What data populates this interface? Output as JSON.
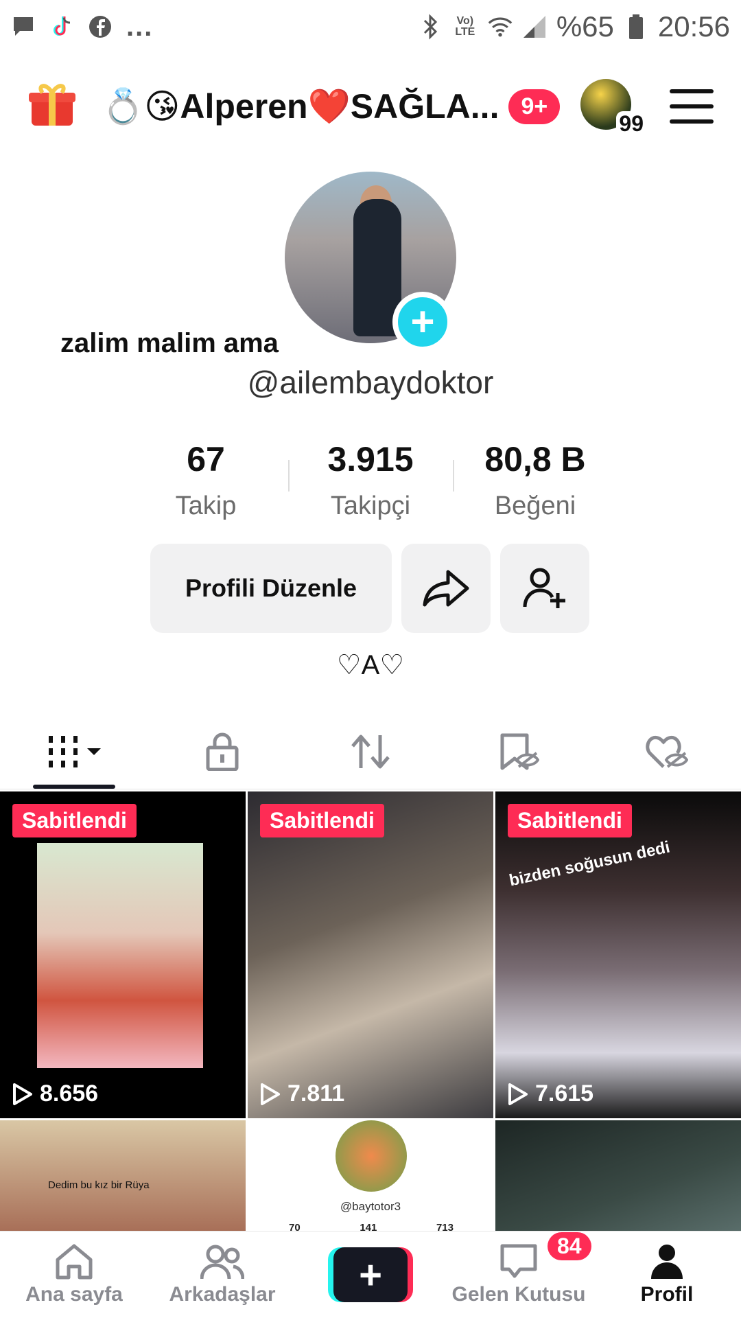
{
  "status_bar": {
    "left_icons": [
      "message-icon",
      "tiktok-icon",
      "facebook-icon"
    ],
    "dots": "...",
    "network": "Vo) LTE",
    "battery_text": "%65",
    "time": "20:56"
  },
  "header": {
    "title": "💍😘Alperen❤️SAĞLA...",
    "notif_badge": "9+",
    "avatar_count": "99"
  },
  "profile": {
    "nickname": "zalim malim ama",
    "username": "@ailembaydoktor",
    "stats": [
      {
        "value": "67",
        "label": "Takip"
      },
      {
        "value": "3.915",
        "label": "Takipçi"
      },
      {
        "value": "80,8 B",
        "label": "Beğeni"
      }
    ],
    "edit_button": "Profili Düzenle",
    "bio": "♡A♡"
  },
  "tabs": [
    "videos-icon",
    "lock-icon",
    "repost-icon",
    "saved-icon",
    "liked-icon"
  ],
  "videos": [
    {
      "pinned": "Sabitlendi",
      "views": "8.656"
    },
    {
      "pinned": "Sabitlendi",
      "views": "7.811"
    },
    {
      "pinned": "Sabitlendi",
      "views": "7.615",
      "overlay_text": "bizden soğusun dedi"
    }
  ],
  "row2": {
    "caption": "Dedim bu kız bir Rüya",
    "mini_user": "@baytotor3",
    "mini_stats": [
      "70",
      "141",
      "713"
    ]
  },
  "bottom_nav": {
    "home": "Ana sayfa",
    "friends": "Arkadaşlar",
    "inbox": "Gelen Kutusu",
    "inbox_badge": "84",
    "profile": "Profil"
  }
}
